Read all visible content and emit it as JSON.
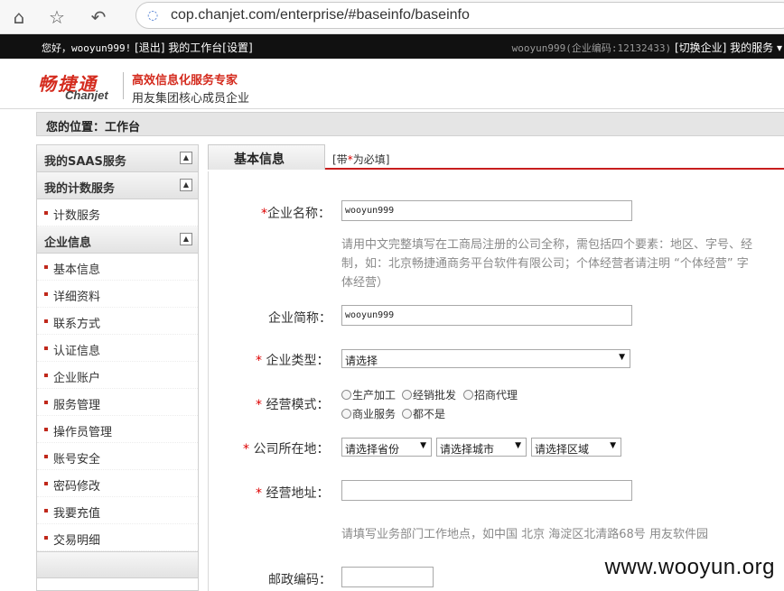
{
  "browser": {
    "url": "cop.chanjet.com/enterprise/#baseinfo/baseinfo",
    "home_icon": "home-icon",
    "star_icon": "star-icon",
    "back_icon": "back-icon"
  },
  "topbar": {
    "greeting": "您好，wooyun999!",
    "logout": "[退出]",
    "workbench": "我的工作台[设置]",
    "account": "wooyun999(企业编码:12132433)",
    "switch_enterprise": "[切换企业]",
    "my_services": "我的服务 ▾"
  },
  "header": {
    "logo_cn": "畅捷通",
    "logo_en": "Chanjet",
    "slogan": "高效信息化服务专家",
    "subslogan": "用友集团核心成员企业"
  },
  "breadcrumb": "您的位置：工作台",
  "sidebar": {
    "sections": [
      {
        "title": "我的SAAS服务"
      },
      {
        "title": "我的计数服务",
        "items": [
          "计数服务"
        ]
      },
      {
        "title": "企业信息",
        "items": [
          "基本信息",
          "详细资料",
          "联系方式",
          "认证信息",
          "企业账户",
          "服务管理",
          "操作员管理",
          "账号安全",
          "密码修改",
          "我要充值",
          "交易明细"
        ]
      }
    ]
  },
  "tabs": {
    "active": "基本信息",
    "note_prefix": "[带",
    "note_star": "*",
    "note_suffix": "为必填]"
  },
  "form": {
    "company_name": {
      "label": "企业名称：",
      "value": "wooyun999"
    },
    "company_name_hint": {
      "line1": "请用中文完整填写在工商局注册的公司全称，需包括四个要素：地区、字号、经",
      "line2": "制，如：北京畅捷通商务平台软件有限公司；个体经营者请注明 “个体经营” 字",
      "line3": "体经营）"
    },
    "short_name": {
      "label": "企业简称：",
      "value": "wooyun999"
    },
    "company_type": {
      "label": "企业类型：",
      "selected": "请选择"
    },
    "business_mode": {
      "label": "经营模式：",
      "options": [
        "生产加工",
        "经销批发",
        "招商代理",
        "商业服务",
        "都不是"
      ]
    },
    "location": {
      "label": "公司所在地：",
      "province": "请选择省份",
      "city": "请选择城市",
      "district": "请选择区域"
    },
    "address": {
      "label": "经营地址：",
      "value": ""
    },
    "address_hint": "请填写业务部门工作地点，如中国 北京 海淀区北清路68号 用友软件园",
    "postcode": {
      "label": "邮政编码：",
      "value": ""
    },
    "required_mark": "*"
  },
  "watermark": "www.wooyun.org"
}
